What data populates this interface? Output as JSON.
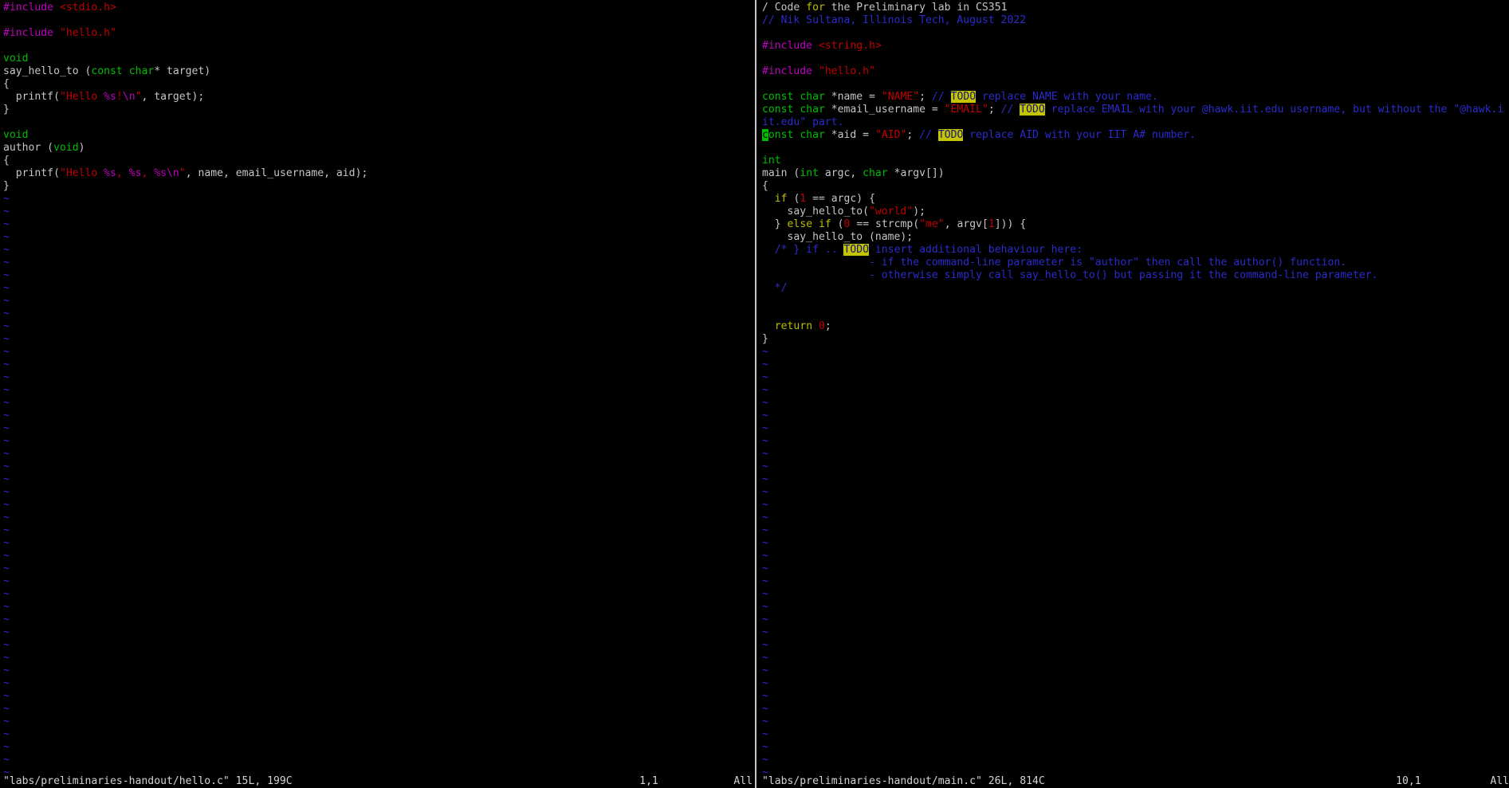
{
  "colors": {
    "background": "#000000",
    "normal_text": "#c6c6c6",
    "preprocessor": "#bd00bd",
    "string_and_number": "#c00000",
    "special_char": "#bd00bd",
    "type_keyword": "#00bd00",
    "statement_keyword": "#bdbd00",
    "comment": "#2b2bcc",
    "tilde": "#2b2bcc",
    "todo_bg": "#c4c400",
    "todo_fg": "#14147a",
    "cursor_bg": "#00bd00",
    "window_separator": "#c6c6c6"
  },
  "panes": [
    {
      "file": "labs/preliminaries-handout/hello.c",
      "lines": [
        [
          [
            "pp",
            "#include"
          ],
          [
            "n",
            " "
          ],
          [
            "str",
            "<stdio.h>"
          ]
        ],
        [],
        [
          [
            "pp",
            "#include"
          ],
          [
            "n",
            " "
          ],
          [
            "str",
            "\"hello.h\""
          ]
        ],
        [],
        [
          [
            "typ",
            "void"
          ]
        ],
        [
          [
            "n",
            "say_hello_to ("
          ],
          [
            "typ",
            "const"
          ],
          [
            "n",
            " "
          ],
          [
            "typ",
            "char"
          ],
          [
            "n",
            "* target)"
          ]
        ],
        [
          [
            "n",
            "{"
          ]
        ],
        [
          [
            "n",
            "  printf("
          ],
          [
            "str",
            "\"Hello "
          ],
          [
            "spc",
            "%s"
          ],
          [
            "str",
            "!"
          ],
          [
            "spc",
            "\\n"
          ],
          [
            "str",
            "\""
          ],
          [
            "n",
            ", target);"
          ]
        ],
        [
          [
            "n",
            "}"
          ]
        ],
        [],
        [
          [
            "typ",
            "void"
          ]
        ],
        [
          [
            "n",
            "author ("
          ],
          [
            "typ",
            "void"
          ],
          [
            "n",
            ")"
          ]
        ],
        [
          [
            "n",
            "{"
          ]
        ],
        [
          [
            "n",
            "  printf("
          ],
          [
            "str",
            "\"Hello "
          ],
          [
            "spc",
            "%s"
          ],
          [
            "str",
            ", "
          ],
          [
            "spc",
            "%s"
          ],
          [
            "str",
            ", "
          ],
          [
            "spc",
            "%s"
          ],
          [
            "spc",
            "\\n"
          ],
          [
            "str",
            "\""
          ],
          [
            "n",
            ", name, email_username, aid);"
          ]
        ],
        [
          [
            "n",
            "}"
          ]
        ]
      ],
      "tildes": 46,
      "status": {
        "file_info": "\"labs/preliminaries-handout/hello.c\" 15L, 199C",
        "cursor_pos": "1,1",
        "scroll_pos": "All"
      }
    },
    {
      "file": "labs/preliminaries-handout/main.c",
      "lines": [
        [
          [
            "n",
            "/ Code "
          ],
          [
            "stm",
            "for"
          ],
          [
            "n",
            " the Preliminary lab in CS351"
          ]
        ],
        [
          [
            "cm",
            "// Nik Sultana, Illinois Tech, August 2022"
          ]
        ],
        [],
        [
          [
            "pp",
            "#include"
          ],
          [
            "n",
            " "
          ],
          [
            "str",
            "<string.h>"
          ]
        ],
        [],
        [
          [
            "pp",
            "#include"
          ],
          [
            "n",
            " "
          ],
          [
            "str",
            "\"hello.h\""
          ]
        ],
        [],
        [
          [
            "typ",
            "const"
          ],
          [
            "n",
            " "
          ],
          [
            "typ",
            "char"
          ],
          [
            "n",
            " *name = "
          ],
          [
            "str",
            "\"NAME\""
          ],
          [
            "n",
            "; "
          ],
          [
            "cm",
            "// "
          ],
          [
            "todo",
            "TODO"
          ],
          [
            "cm",
            " replace NAME with your name."
          ]
        ],
        [
          [
            "typ",
            "const"
          ],
          [
            "n",
            " "
          ],
          [
            "typ",
            "char"
          ],
          [
            "n",
            " *email_username = "
          ],
          [
            "str",
            "\"EMAIL\""
          ],
          [
            "n",
            "; "
          ],
          [
            "cm",
            "// "
          ],
          [
            "todo",
            "TODO"
          ],
          [
            "cm",
            " replace EMAIL with your @hawk.iit.edu username, but without the \"@hawk.i"
          ]
        ],
        [
          [
            "cm",
            "it.edu\" part."
          ]
        ],
        [
          [
            "cur",
            "c"
          ],
          [
            "typ",
            "onst"
          ],
          [
            "n",
            " "
          ],
          [
            "typ",
            "char"
          ],
          [
            "n",
            " *aid = "
          ],
          [
            "str",
            "\"AID\""
          ],
          [
            "n",
            "; "
          ],
          [
            "cm",
            "// "
          ],
          [
            "todo",
            "TODO"
          ],
          [
            "cm",
            " replace AID with your IIT A# number."
          ]
        ],
        [],
        [
          [
            "typ",
            "int"
          ]
        ],
        [
          [
            "n",
            "main ("
          ],
          [
            "typ",
            "int"
          ],
          [
            "n",
            " argc, "
          ],
          [
            "typ",
            "char"
          ],
          [
            "n",
            " *argv[])"
          ]
        ],
        [
          [
            "n",
            "{"
          ]
        ],
        [
          [
            "n",
            "  "
          ],
          [
            "stm",
            "if"
          ],
          [
            "n",
            " ("
          ],
          [
            "num",
            "1"
          ],
          [
            "n",
            " == argc) {"
          ]
        ],
        [
          [
            "n",
            "    say_hello_to("
          ],
          [
            "str",
            "\"world\""
          ],
          [
            "n",
            ");"
          ]
        ],
        [
          [
            "n",
            "  } "
          ],
          [
            "stm",
            "else"
          ],
          [
            "n",
            " "
          ],
          [
            "stm",
            "if"
          ],
          [
            "n",
            " ("
          ],
          [
            "num",
            "0"
          ],
          [
            "n",
            " == strcmp("
          ],
          [
            "str",
            "\"me\""
          ],
          [
            "n",
            ", argv["
          ],
          [
            "num",
            "1"
          ],
          [
            "n",
            "])) {"
          ]
        ],
        [
          [
            "n",
            "    say_hello_to (name);"
          ]
        ],
        [
          [
            "cm",
            "  /* } if .. "
          ],
          [
            "todo",
            "TODO"
          ],
          [
            "cm",
            " insert additional behaviour here:"
          ]
        ],
        [
          [
            "cm",
            "                 - if the command-line parameter is \"author\" then call the author() function."
          ]
        ],
        [
          [
            "cm",
            "                 - otherwise simply call say_hello_to() but passing it the command-line parameter."
          ]
        ],
        [
          [
            "cm",
            "  */"
          ]
        ],
        [],
        [],
        [
          [
            "n",
            "  "
          ],
          [
            "stm",
            "return"
          ],
          [
            "n",
            " "
          ],
          [
            "num",
            "0"
          ],
          [
            "n",
            ";"
          ]
        ],
        [
          [
            "n",
            "}"
          ]
        ]
      ],
      "tildes": 34,
      "status": {
        "file_info": "\"labs/preliminaries-handout/main.c\" 26L, 814C",
        "cursor_pos": "10,1",
        "scroll_pos": "All"
      }
    }
  ]
}
